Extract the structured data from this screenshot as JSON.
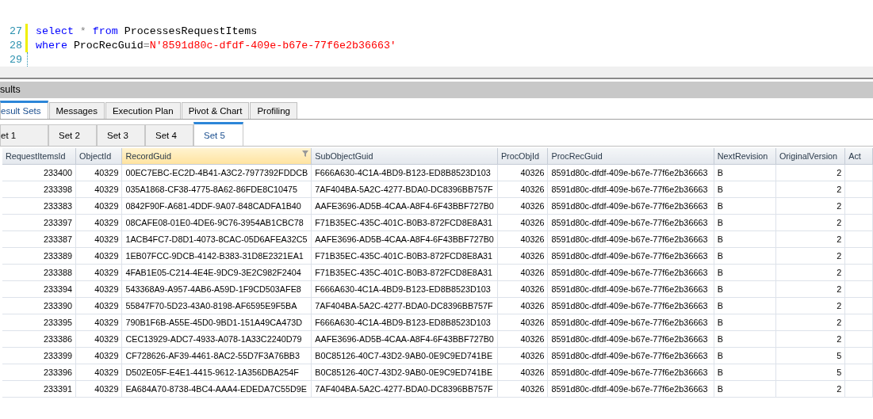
{
  "editor": {
    "lines": [
      {
        "number": "27",
        "modified": true,
        "tokens": [
          {
            "kind": "keyword",
            "text": "select"
          },
          {
            "kind": "operator",
            "text": " * "
          },
          {
            "kind": "keyword",
            "text": "from"
          },
          {
            "kind": "plain",
            "text": " ProcessesRequestItems"
          }
        ]
      },
      {
        "number": "28",
        "modified": true,
        "tokens": [
          {
            "kind": "keyword",
            "text": "where"
          },
          {
            "kind": "plain",
            "text": " ProcRecGuid"
          },
          {
            "kind": "operator",
            "text": "="
          },
          {
            "kind": "string",
            "text": "N'8591d80c-dfdf-409e-b67e-77f6e2b36663'"
          }
        ]
      },
      {
        "number": "29",
        "modified": false
      }
    ]
  },
  "results": {
    "title": "sults",
    "tabs": [
      {
        "label": "esult Sets",
        "selected": true
      },
      {
        "label": "Messages",
        "selected": false
      },
      {
        "label": "Execution Plan",
        "selected": false
      },
      {
        "label": "Pivot & Chart",
        "selected": false
      },
      {
        "label": "Profiling",
        "selected": false
      }
    ],
    "set_tabs": [
      {
        "label": "et 1",
        "selected": false
      },
      {
        "label": "Set 2",
        "selected": false
      },
      {
        "label": "Set 3",
        "selected": false
      },
      {
        "label": "Set 4",
        "selected": false
      },
      {
        "label": "Set 5",
        "selected": true
      }
    ],
    "table": {
      "columns": [
        {
          "label": "RequestItemsId",
          "kind": "number",
          "selected": false,
          "filtered": false
        },
        {
          "label": "ObjectId",
          "kind": "number",
          "selected": false,
          "filtered": false
        },
        {
          "label": "RecordGuid",
          "kind": "text",
          "selected": true,
          "filtered": true
        },
        {
          "label": "SubObjectGuid",
          "kind": "text",
          "selected": false,
          "filtered": false
        },
        {
          "label": "ProcObjId",
          "kind": "number",
          "selected": false,
          "filtered": false
        },
        {
          "label": "ProcRecGuid",
          "kind": "text",
          "selected": false,
          "filtered": false
        },
        {
          "label": "NextRevision",
          "kind": "text",
          "selected": false,
          "filtered": false
        },
        {
          "label": "OriginalVersion",
          "kind": "number",
          "selected": false,
          "filtered": false
        },
        {
          "label": "Act",
          "kind": "text",
          "selected": false,
          "filtered": false
        }
      ],
      "rows": [
        [
          "233400",
          "40329",
          "00EC7EBC-EC2D-4B41-A3C2-7977392FDDCB",
          "F666A630-4C1A-4BD9-B123-ED8B8523D103",
          "40326",
          "8591d80c-dfdf-409e-b67e-77f6e2b36663",
          "B",
          "2"
        ],
        [
          "233398",
          "40329",
          "035A1868-CF38-4775-8A62-86FDE8C10475",
          "7AF404BA-5A2C-4277-BDA0-DC8396BB757F",
          "40326",
          "8591d80c-dfdf-409e-b67e-77f6e2b36663",
          "B",
          "2"
        ],
        [
          "233383",
          "40329",
          "0842F90F-A681-4DDF-9A07-848CADFA1B40",
          "AAFE3696-AD5B-4CAA-A8F4-6F43BBF727B0",
          "40326",
          "8591d80c-dfdf-409e-b67e-77f6e2b36663",
          "B",
          "2"
        ],
        [
          "233397",
          "40329",
          "08CAFE08-01E0-4DE6-9C76-3954AB1CBC78",
          "F71B35EC-435C-401C-B0B3-872FCD8E8A31",
          "40326",
          "8591d80c-dfdf-409e-b67e-77f6e2b36663",
          "B",
          "2"
        ],
        [
          "233387",
          "40329",
          "1ACB4FC7-D8D1-4073-8CAC-05D6AFEA32C5",
          "AAFE3696-AD5B-4CAA-A8F4-6F43BBF727B0",
          "40326",
          "8591d80c-dfdf-409e-b67e-77f6e2b36663",
          "B",
          "2"
        ],
        [
          "233389",
          "40329",
          "1EB07FCC-9DCB-4142-B383-31D8E2321EA1",
          "F71B35EC-435C-401C-B0B3-872FCD8E8A31",
          "40326",
          "8591d80c-dfdf-409e-b67e-77f6e2b36663",
          "B",
          "2"
        ],
        [
          "233388",
          "40329",
          "4FAB1E05-C214-4E4E-9DC9-3E2C982F2404",
          "F71B35EC-435C-401C-B0B3-872FCD8E8A31",
          "40326",
          "8591d80c-dfdf-409e-b67e-77f6e2b36663",
          "B",
          "2"
        ],
        [
          "233394",
          "40329",
          "543368A9-A957-4AB6-A59D-1F9CD503AFE8",
          "F666A630-4C1A-4BD9-B123-ED8B8523D103",
          "40326",
          "8591d80c-dfdf-409e-b67e-77f6e2b36663",
          "B",
          "2"
        ],
        [
          "233390",
          "40329",
          "55847F70-5D23-43A0-8198-AF6595E9F5BA",
          "7AF404BA-5A2C-4277-BDA0-DC8396BB757F",
          "40326",
          "8591d80c-dfdf-409e-b67e-77f6e2b36663",
          "B",
          "2"
        ],
        [
          "233395",
          "40329",
          "790B1F6B-A55E-45D0-9BD1-151A49CA473D",
          "F666A630-4C1A-4BD9-B123-ED8B8523D103",
          "40326",
          "8591d80c-dfdf-409e-b67e-77f6e2b36663",
          "B",
          "2"
        ],
        [
          "233386",
          "40329",
          "CEC13929-ADC7-4933-A078-1A33C2240D79",
          "AAFE3696-AD5B-4CAA-A8F4-6F43BBF727B0",
          "40326",
          "8591d80c-dfdf-409e-b67e-77f6e2b36663",
          "B",
          "2"
        ],
        [
          "233399",
          "40329",
          "CF728626-AF39-4461-8AC2-55D7F3A76BB3",
          "B0C85126-40C7-43D2-9AB0-0E9C9ED741BE",
          "40326",
          "8591d80c-dfdf-409e-b67e-77f6e2b36663",
          "B",
          "5"
        ],
        [
          "233396",
          "40329",
          "D502E05F-E4E1-4415-9612-1A356DBA254F",
          "B0C85126-40C7-43D2-9AB0-0E9C9ED741BE",
          "40326",
          "8591d80c-dfdf-409e-b67e-77f6e2b36663",
          "B",
          "5"
        ],
        [
          "233391",
          "40329",
          "EA684A70-8738-4BC4-AAA4-EDEDA7C55D9E",
          "7AF404BA-5A2C-4277-BDA0-DC8396BB757F",
          "40326",
          "8591d80c-dfdf-409e-b67e-77f6e2b36663",
          "B",
          "2"
        ]
      ]
    }
  }
}
